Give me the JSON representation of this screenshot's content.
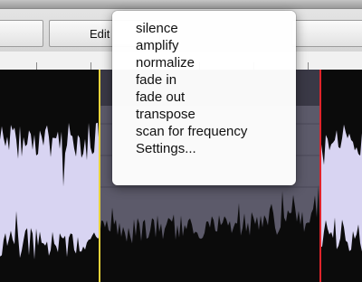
{
  "toolbar": {
    "edit_label": "Edit",
    "left_label": "",
    "right_label": ""
  },
  "selection": {
    "start_marker_color": "#e8d23a",
    "end_marker_color": "#e0242b",
    "selection_color": "#5c5a6a",
    "unselected_color": "#d8d4f2",
    "wave_color": "#0b0b0b"
  },
  "context_menu": {
    "items": [
      "silence",
      "amplify",
      "normalize",
      "fade in",
      "fade out",
      "transpose",
      "scan for frequency",
      "Settings..."
    ]
  }
}
